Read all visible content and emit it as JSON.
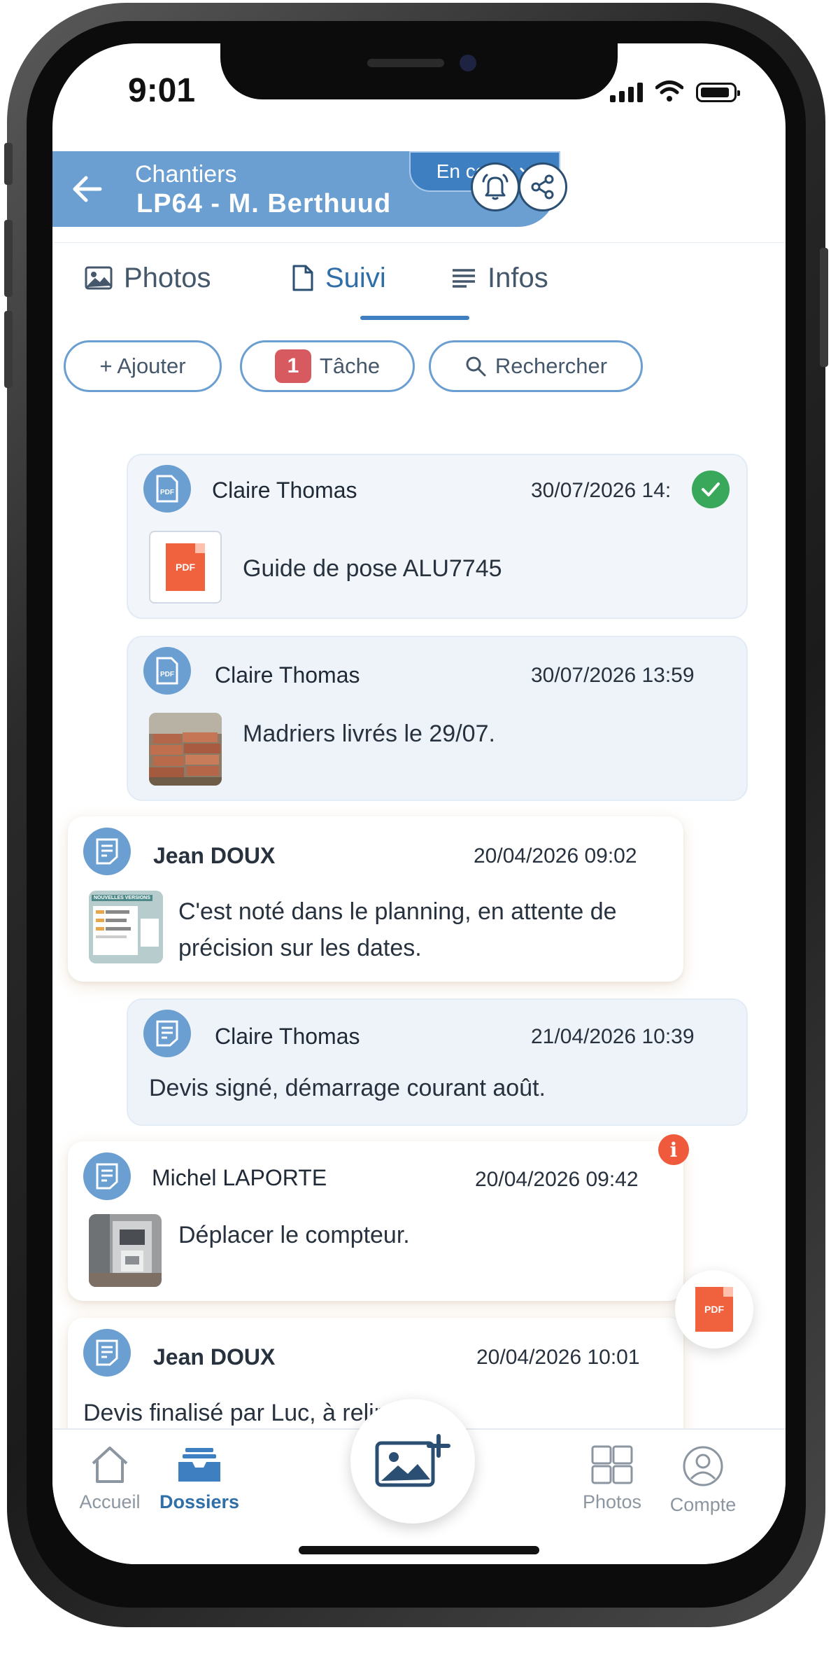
{
  "status_bar": {
    "time": "9:01"
  },
  "header": {
    "subtitle": "Chantiers",
    "title": "LP64 - M. Berthuud",
    "status": "En cours"
  },
  "tabs": [
    {
      "label": "Photos",
      "icon": "image-icon"
    },
    {
      "label": "Suivi",
      "icon": "document-icon",
      "active": true
    },
    {
      "label": "Infos",
      "icon": "lines-icon"
    }
  ],
  "actions": {
    "add": "+ Ajouter",
    "task_count": "1",
    "task": "Tâche",
    "search": "Rechercher"
  },
  "feed": [
    {
      "author": "Claire Thomas",
      "date": "30/07/2026 14:",
      "message": "Guide de pose ALU7745",
      "attachment": "pdf",
      "status": "done",
      "icon": "pdf-icon"
    },
    {
      "author": "Claire Thomas",
      "date": "30/07/2026 13:59",
      "message": "Madriers livrés le 29/07.",
      "attachment": "photo-planks",
      "icon": "pdf-icon"
    },
    {
      "author": "Jean DOUX",
      "date": "20/04/2026 09:02",
      "message": "C'est noté dans le planning, en attente de précision sur les dates.",
      "attachment": "document-preview",
      "thumb_caption": "NOUVELLES VERSIONS",
      "icon": "note-icon"
    },
    {
      "author": "Claire Thomas",
      "date": "21/04/2026 10:39",
      "message": "Devis signé, démarrage courant août.",
      "icon": "note-icon"
    },
    {
      "author": "Michel LAPORTE",
      "date": "20/04/2026 09:42",
      "message": "Déplacer le compteur.",
      "attachment": "photo-meter",
      "badge": "i",
      "icon": "note-icon"
    },
    {
      "author": "Jean DOUX",
      "date": "20/04/2026 10:01",
      "message": "Devis finalisé par Luc,  à relire",
      "icon": "note-icon"
    }
  ],
  "pdf_label": "PDF",
  "bottom_nav": [
    {
      "label": "Accueil",
      "icon": "home-icon"
    },
    {
      "label": "Dossiers",
      "icon": "folder-tray-icon",
      "active": true
    },
    {
      "label": "Photos",
      "icon": "grid-icon"
    },
    {
      "label": "Compte",
      "icon": "user-icon"
    }
  ],
  "colors": {
    "accent": "#3d7fc1",
    "header": "#6b9fd1",
    "alert": "#f05a3c",
    "success": "#3aa85a",
    "task_badge": "#d65a5f"
  }
}
